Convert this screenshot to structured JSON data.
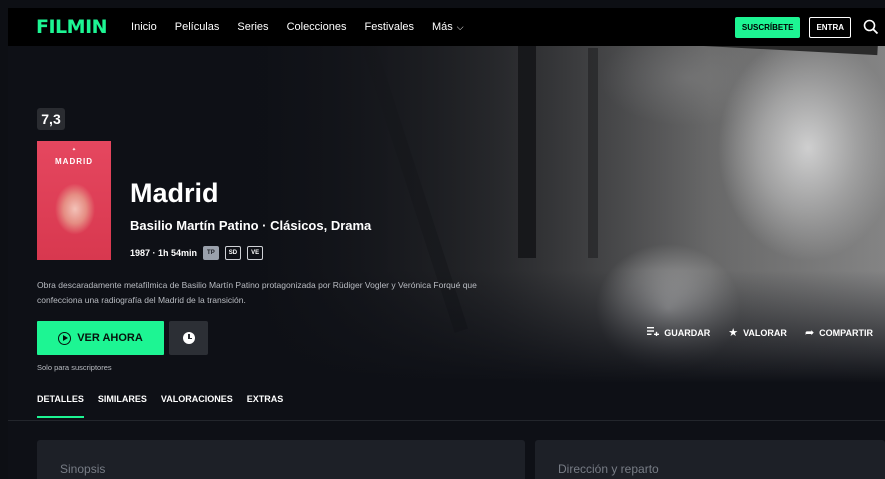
{
  "header": {
    "logo": "FILMIN",
    "nav": [
      "Inicio",
      "Películas",
      "Series",
      "Colecciones",
      "Festivales",
      "Más"
    ],
    "subscribe_label": "SUSCRÍBETE",
    "login_label": "ENTRA"
  },
  "movie": {
    "rating": "7,3",
    "poster_title": "MADRID",
    "title": "Madrid",
    "subtitle": "Basilio Martín Patino · Clásicos, Drama",
    "year_duration": "1987 · 1h 54min",
    "tags": [
      "TP",
      "SD",
      "VE"
    ],
    "description": "Obra descaradamente metafílmica de Basilio Martín Patino protagonizada por Rüdiger Vogler y Verónica Forqué que confecciona una radiografía del Madrid de la transición."
  },
  "actions": {
    "watch_label": "VER AHORA",
    "subscribers_only": "Solo para suscriptores",
    "save_label": "GUARDAR",
    "rate_label": "VALORAR",
    "share_label": "COMPARTIR"
  },
  "tabs": [
    "DETALLES",
    "SIMILARES",
    "VALORACIONES",
    "EXTRAS"
  ],
  "cards": {
    "synopsis": "Sinopsis",
    "cast": "Dirección y reparto"
  },
  "colors": {
    "accent": "#1df593",
    "background": "#0e1016",
    "card": "#1d2027"
  }
}
